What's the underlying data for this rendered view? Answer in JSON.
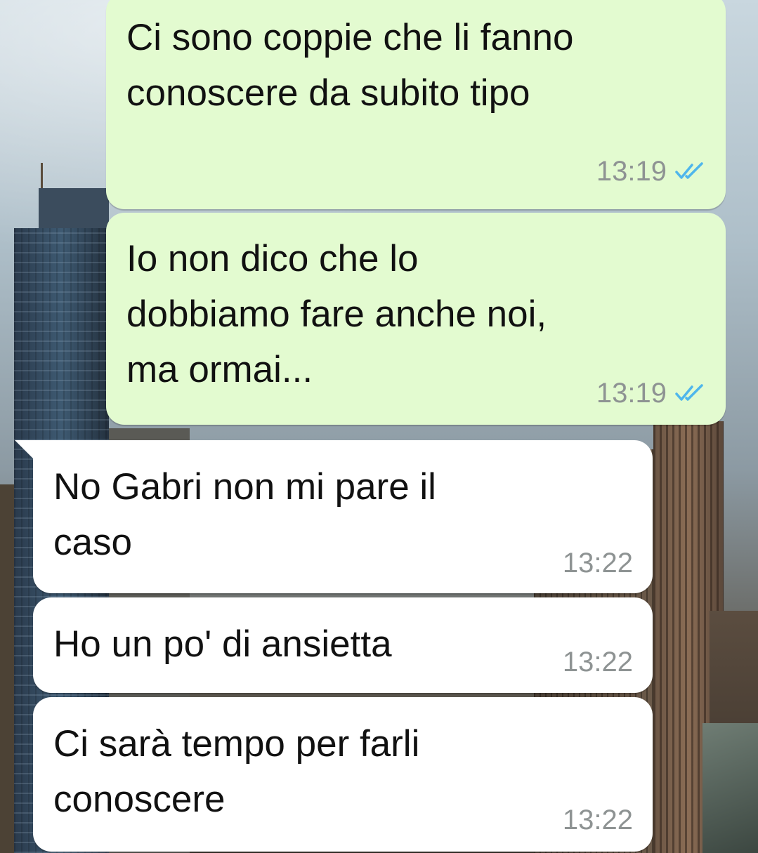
{
  "colors": {
    "outgoing_bubble": "#e3fbd0",
    "incoming_bubble": "#ffffff",
    "time": "#8e9393",
    "read_ticks": "#4fb6ec"
  },
  "messages": [
    {
      "direction": "out",
      "text": "Ci sono coppie che li fanno\nconoscere da subito tipo",
      "time": "13:19",
      "status_icon": "double-check-read-icon"
    },
    {
      "direction": "out",
      "text": "Io non dico che lo\ndobbiamo fare anche noi,\nma ormai...",
      "time": "13:19",
      "status_icon": "double-check-read-icon"
    },
    {
      "direction": "in",
      "text": "No Gabri non mi pare il\ncaso",
      "time": "13:22"
    },
    {
      "direction": "in",
      "text": "Ho un po' di ansietta",
      "time": "13:22"
    },
    {
      "direction": "in",
      "text": "Ci sarà tempo per farli\nconoscere",
      "time": "13:22"
    }
  ]
}
